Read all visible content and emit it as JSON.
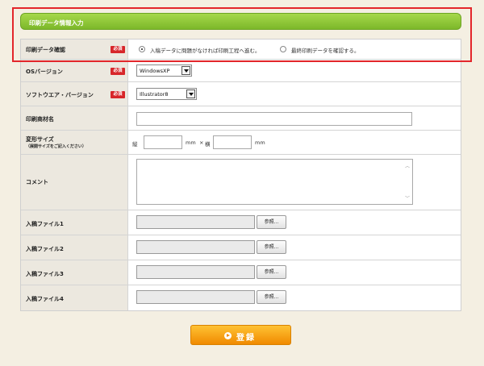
{
  "header": {
    "title": "印刷データ情報入力"
  },
  "required_badge": "必須",
  "rows": {
    "confirm": {
      "label": "印刷データ確認",
      "options": [
        {
          "text": "入稿データに問題がなければ印刷工程へ進む。",
          "selected": true
        },
        {
          "text": "最終印刷データを確認する。",
          "selected": false
        }
      ]
    },
    "os": {
      "label": "OSバージョン",
      "value": "WindowsXP"
    },
    "software": {
      "label": "ソフトウエア・バージョン",
      "value": "Illustrator8"
    },
    "material": {
      "label": "印刷商材名",
      "value": ""
    },
    "size": {
      "label": "変形サイズ",
      "sublabel": "（展開サイズをご記入ください）",
      "height_label": "縦",
      "width_label": "横",
      "unit": "mm",
      "sep": "×"
    },
    "comment": {
      "label": "コメント",
      "value": ""
    },
    "files": [
      {
        "label": "入稿ファイル1",
        "button": "参照..."
      },
      {
        "label": "入稿ファイル2",
        "button": "参照..."
      },
      {
        "label": "入稿ファイル3",
        "button": "参照..."
      },
      {
        "label": "入稿ファイル4",
        "button": "参照..."
      }
    ]
  },
  "submit": {
    "label": "登録"
  },
  "colors": {
    "header_green": "#8cc63f",
    "required_red": "#d7262a",
    "submit_orange": "#f8a51c",
    "highlight_red": "#e3262b"
  }
}
